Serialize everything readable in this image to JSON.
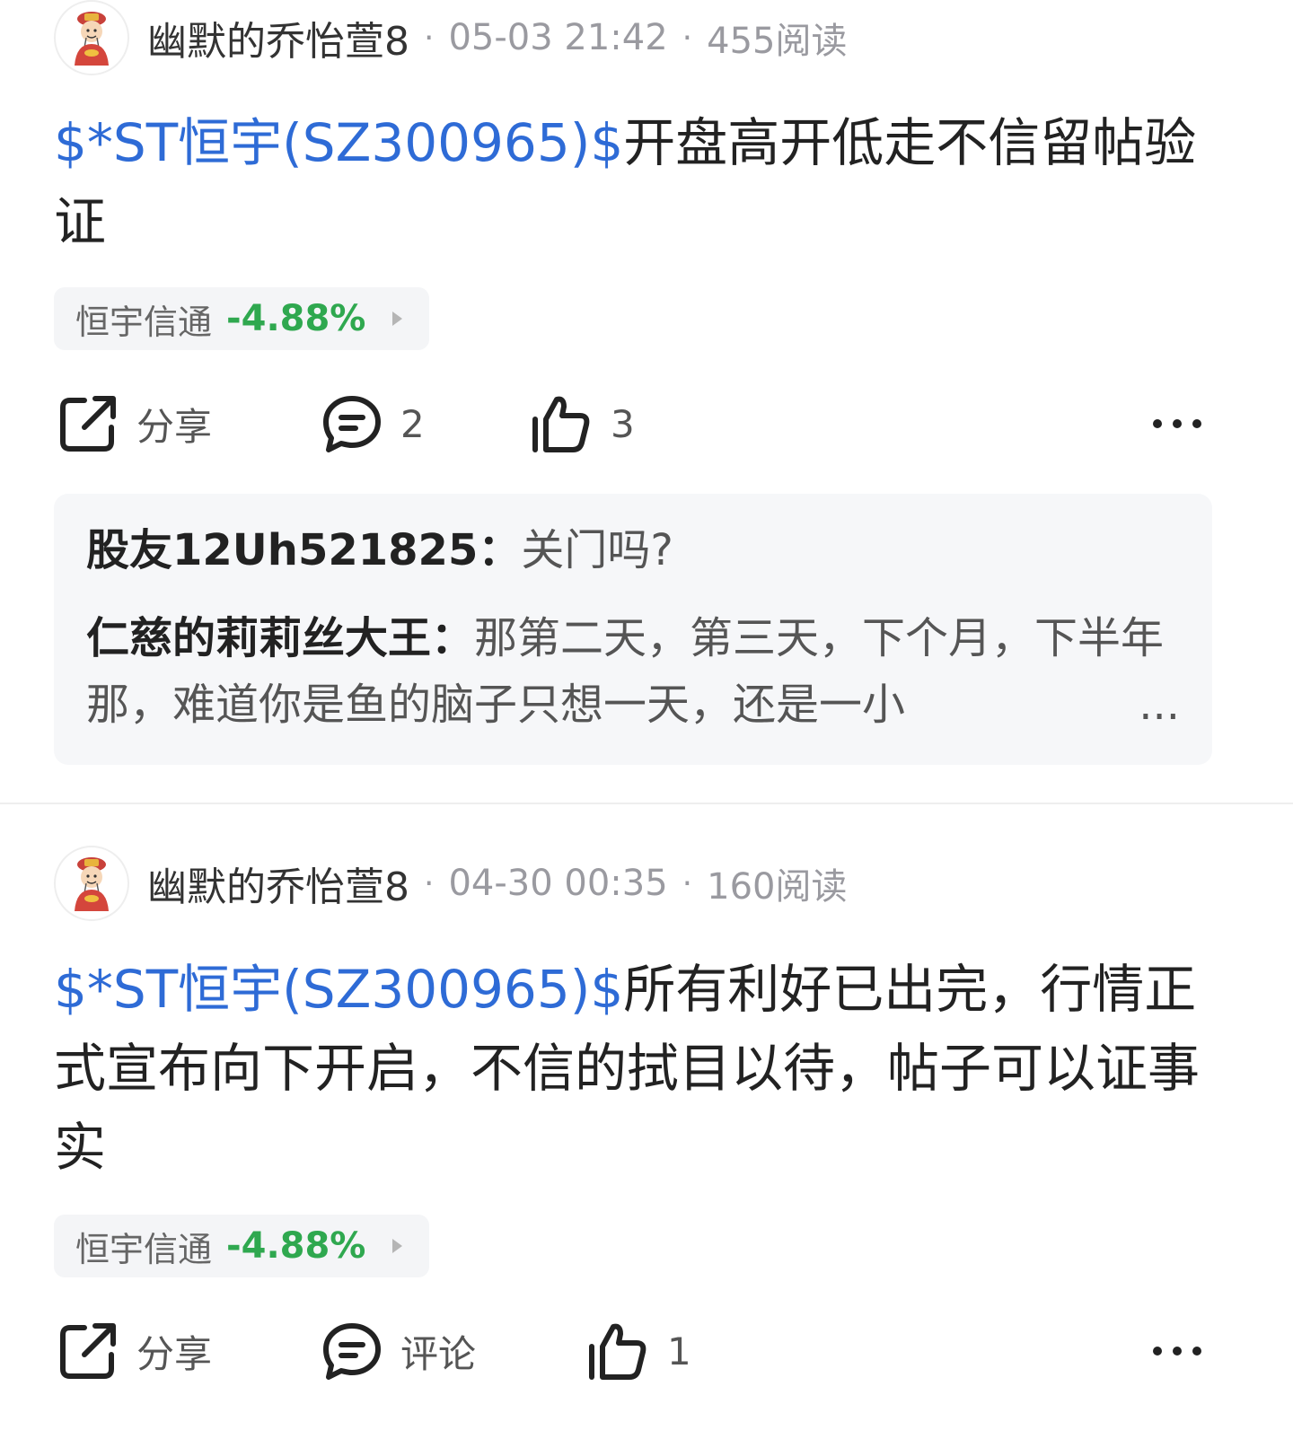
{
  "posts": [
    {
      "author": "幽默的乔怡萱8",
      "separator": "·",
      "datetime": "05-03 21:42",
      "reads": "455阅读",
      "stock_link": "$*ST恒宇(SZ300965)$",
      "body_text": "开盘高开低走不信留帖验证",
      "stock_chip": {
        "name": "恒宇信通",
        "change": "-4.88%"
      },
      "actions": {
        "share_label": "分享",
        "comment_label": "2",
        "like_label": "3"
      },
      "comments": [
        {
          "user": "股友12Uh521825：",
          "text": "关门吗?"
        },
        {
          "user": "仁慈的莉莉丝大王：",
          "text": "那第二天，第三天，下个月，下半年那，难道你是鱼的脑子只想一天，还是一小",
          "ellipsis": "..."
        }
      ]
    },
    {
      "author": "幽默的乔怡萱8",
      "separator": "·",
      "datetime": "04-30 00:35",
      "reads": "160阅读",
      "stock_link": "$*ST恒宇(SZ300965)$",
      "body_text": "所有利好已出完，行情正式宣布向下开启，不信的拭目以待，帖子可以证事实",
      "stock_chip": {
        "name": "恒宇信通",
        "change": "-4.88%"
      },
      "actions": {
        "share_label": "分享",
        "comment_label": "评论",
        "like_label": "1"
      }
    }
  ],
  "colors": {
    "link": "#2e6bd6",
    "down": "#2fa84f",
    "meta": "#9a9aa0"
  },
  "icons": [
    "avatar-caishen-icon",
    "share-icon",
    "comment-icon",
    "like-icon",
    "more-icon",
    "chevron-right-icon"
  ]
}
